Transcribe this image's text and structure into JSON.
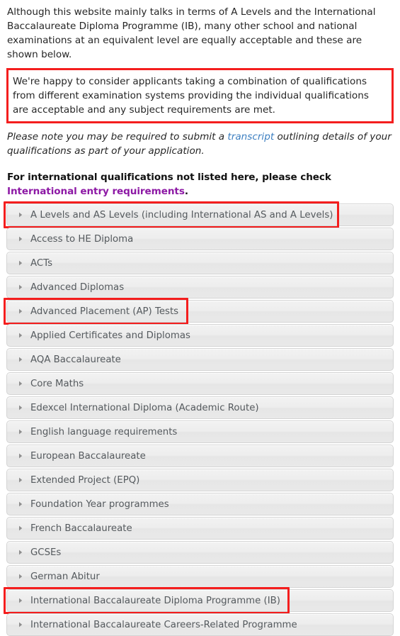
{
  "intro": {
    "paragraph": "Although this website mainly talks in terms of A Levels and the International Baccalaureate Diploma Programme (IB), many other school and national examinations at an equivalent level are equally acceptable and these are shown below."
  },
  "highlight": {
    "text": "We're happy to consider applicants taking a combination of qualifications from different examination systems providing the individual qualifications are acceptable and any subject requirements are met."
  },
  "note": {
    "before": "Please note you may be required to submit a ",
    "link": "transcript",
    "after": " outlining details of your qualifications as part of your application."
  },
  "callout": {
    "before": "For international qualifications not listed here, please check ",
    "link": "International entry requirements",
    "after": "."
  },
  "colors": {
    "annotation": "#f41e1e",
    "transcript_link": "#3d7fc1",
    "international_link": "#8d19a5",
    "accordion_text": "#555a5e",
    "accordion_border": "#d4d4d4"
  },
  "accordion": {
    "arrow_icon": "triangle-right-icon",
    "items": [
      {
        "label": "A Levels and AS Levels (including International AS and A Levels)",
        "annotated": true,
        "annot_width": 474
      },
      {
        "label": "Access to HE Diploma",
        "annotated": false
      },
      {
        "label": "ACTs",
        "annotated": false
      },
      {
        "label": "Advanced Diplomas",
        "annotated": false
      },
      {
        "label": "Advanced Placement (AP) Tests",
        "annotated": true,
        "annot_width": 261
      },
      {
        "label": "Applied Certificates and Diplomas",
        "annotated": false
      },
      {
        "label": "AQA Baccalaureate",
        "annotated": false
      },
      {
        "label": "Core Maths",
        "annotated": false
      },
      {
        "label": "Edexcel International Diploma (Academic Route)",
        "annotated": false
      },
      {
        "label": "English language requirements",
        "annotated": false
      },
      {
        "label": "European Baccalaureate",
        "annotated": false
      },
      {
        "label": "Extended Project (EPQ)",
        "annotated": false
      },
      {
        "label": "Foundation Year programmes",
        "annotated": false
      },
      {
        "label": "French Baccalaureate",
        "annotated": false
      },
      {
        "label": "GCSEs",
        "annotated": false
      },
      {
        "label": "German Abitur",
        "annotated": false
      },
      {
        "label": "International Baccalaureate Diploma Programme (IB)",
        "annotated": true,
        "annot_width": 404
      },
      {
        "label": "International Baccalaureate Careers-Related Programme",
        "annotated": false
      }
    ]
  }
}
